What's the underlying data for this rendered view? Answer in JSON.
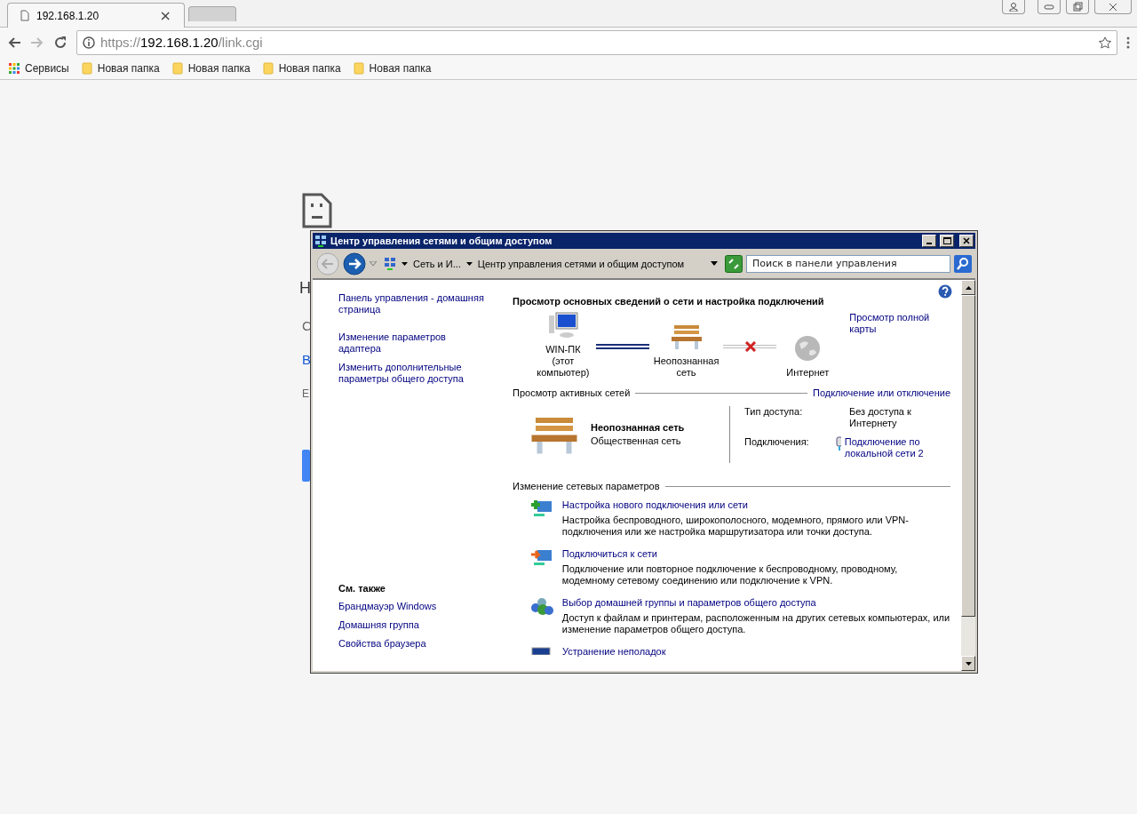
{
  "browser": {
    "tabs": [
      {
        "title": "192.168.1.20",
        "close": "×",
        "selected": true
      },
      {
        "selected": false
      }
    ],
    "address": {
      "scheme": "https://",
      "host": "192.168.1.20",
      "path": "/link.cgi"
    },
    "bookmarks": [
      {
        "label": "Сервисы",
        "kind": "apps"
      },
      {
        "label": "Новая папка",
        "kind": "folder"
      },
      {
        "label": "Новая папка",
        "kind": "folder"
      },
      {
        "label": "Новая папка",
        "kind": "folder"
      },
      {
        "label": "Новая папка",
        "kind": "folder"
      }
    ]
  },
  "error_page": {
    "heading": "Н",
    "text": "С",
    "link": "В",
    "code": "E"
  },
  "window": {
    "title": "Центр управления сетями и общим доступом",
    "breadcrumbs": [
      "Сеть и И...",
      "Центр управления сетями и общим доступом"
    ],
    "search": {
      "placeholder": "Поиск в панели управления"
    },
    "sidebar": {
      "links": [
        "Панель управления - домашняя страница",
        "Изменение параметров адаптера",
        "Изменить дополнительные параметры общего доступа"
      ],
      "see_also_title": "См. также",
      "see_also": [
        "Брандмауэр Windows",
        "Домашняя группа",
        "Свойства браузера"
      ]
    },
    "main": {
      "title": "Просмотр основных сведений о сети и настройка подключений",
      "full_map": "Просмотр полной карты",
      "map": [
        {
          "kind": "computer",
          "label": "WIN-ПК\n(этот компьютер)"
        },
        {
          "kind": "link",
          "connected": true
        },
        {
          "kind": "bench",
          "label": "Неопознанная сеть"
        },
        {
          "kind": "link",
          "connected": false
        },
        {
          "kind": "globe",
          "label": "Интернет"
        }
      ],
      "active_title": "Просмотр активных сетей",
      "connect_link": "Подключение или отключение",
      "network": {
        "name": "Неопознанная сеть",
        "type": "Общественная сеть",
        "access_label": "Тип доступа:",
        "access": "Без доступа к Интернету",
        "connections_label": "Подключения:",
        "connection": "Подключение по локальной сети 2"
      },
      "settings_title": "Изменение сетевых параметров",
      "tasks": [
        {
          "kind": "new",
          "title": "Настройка нового подключения или сети",
          "desc": "Настройка беспроводного, широкополосного, модемного, прямого или VPN-подключения или же настройка маршрутизатора или точки доступа."
        },
        {
          "kind": "connect",
          "title": "Подключиться к сети",
          "desc": "Подключение или повторное подключение к беспроводному, проводному, модемному сетевому соединению или подключение к VPN."
        },
        {
          "kind": "homegroup",
          "title": "Выбор домашней группы и параметров общего доступа",
          "desc": "Доступ к файлам и принтерам, расположенным на других сетевых компьютерах, или изменение параметров общего доступа."
        },
        {
          "kind": "trouble",
          "title": "Устранение неполадок"
        }
      ]
    }
  }
}
